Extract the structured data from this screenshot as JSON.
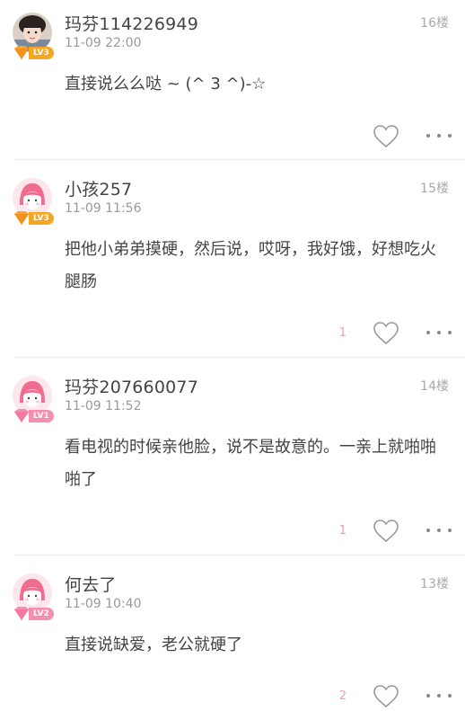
{
  "comments": [
    {
      "username": "玛芬114226949",
      "time": "11-09 22:00",
      "floor": "16楼",
      "level": "LV3",
      "content": "直接说么么哒 ~ (^ 3 ^)-☆",
      "likes": "",
      "avatar": "photo-avatar-icon"
    },
    {
      "username": "小孩257",
      "time": "11-09 11:56",
      "floor": "15楼",
      "level": "LV3",
      "content": "把他小弟弟摸硬，然后说，哎呀，我好饿，好想吃火腿肠",
      "likes": "1",
      "avatar": "default-girl-avatar-icon"
    },
    {
      "username": "玛芬207660077",
      "time": "11-09 11:52",
      "floor": "14楼",
      "level": "LV1",
      "content": "看电视的时候亲他脸，说不是故意的。一亲上就啪啪啪了",
      "likes": "1",
      "avatar": "default-girl-avatar-icon"
    },
    {
      "username": "何去了",
      "time": "11-09 10:40",
      "floor": "13楼",
      "level": "LV2",
      "content": "直接说缺爱，老公就硬了",
      "likes": "2",
      "avatar": "default-girl-avatar-icon"
    }
  ],
  "colors": {
    "level_orange": "#f5a623",
    "level_pink": "#f58fb0",
    "avatar_pink": "#f06d8f",
    "like_count": "#e9a0ae"
  }
}
